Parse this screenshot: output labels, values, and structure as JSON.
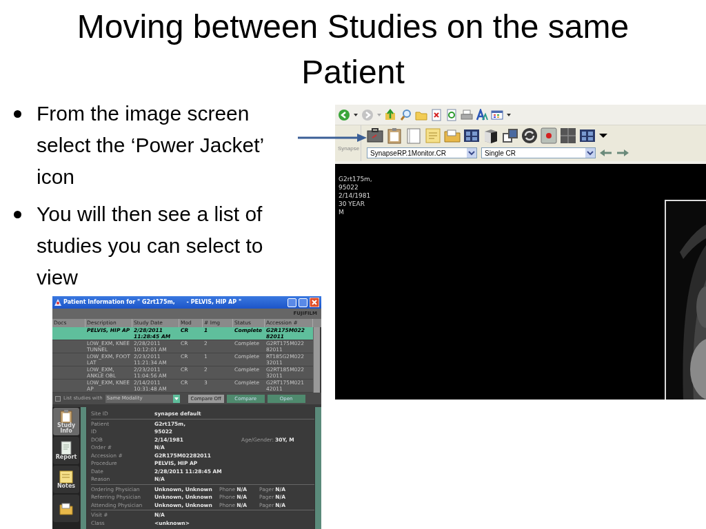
{
  "title": "Moving between Studies on the same Patient",
  "bullets": [
    "From the image screen select the ‘Power Jacket’ icon",
    "You will then see a list of studies you can select to view"
  ],
  "viewer": {
    "toolbar_label": "Synapse",
    "layout_select": "SynapseRP.1Monitor.CR",
    "view_select": "Single CR",
    "overlay_lines": [
      "G2rt175m,",
      "95022",
      "2/14/1981",
      "30 YEAR",
      "M"
    ]
  },
  "dialog": {
    "title": "Patient Information for \" G2rt175m,      - PELVIS, HIP AP \"",
    "brand": "FUJIFILM",
    "columns": [
      "Docs",
      "Description",
      "Study Date",
      "Mod",
      "# Img",
      "Status",
      "Accession #"
    ],
    "rows": [
      {
        "selected": true,
        "cells": [
          "",
          "PELVIS, HIP AP",
          "2/28/2011 11:28:45 AM",
          "CR",
          "1",
          "Complete",
          "G2R175M022 82011"
        ]
      },
      {
        "selected": false,
        "cells": [
          "",
          "LOW_EXM, KNEE TUNNEL",
          "2/28/2011 10:12:01 AM",
          "CR",
          "2",
          "Complete",
          "G2RT175M022 82011"
        ]
      },
      {
        "selected": false,
        "cells": [
          "",
          "LOW_EXM, FOOT LAT",
          "2/23/2011 11:21:34 AM",
          "CR",
          "1",
          "Complete",
          "RT185G2M022 32011"
        ]
      },
      {
        "selected": false,
        "cells": [
          "",
          "LOW_EXM, ANKLE OBL",
          "2/23/2011 11:04:56 AM",
          "CR",
          "2",
          "Complete",
          "G2RT185M022 32011"
        ]
      },
      {
        "selected": false,
        "cells": [
          "",
          "LOW_EXM, KNEE AP",
          "2/14/2011 10:31:48 AM",
          "CR",
          "3",
          "Complete",
          "G2RT175M021 42011"
        ]
      }
    ],
    "list_studies": {
      "label": "List studies with",
      "checked": false
    },
    "filter_select": "Same Modality",
    "buttons": [
      {
        "label": "Compare Off",
        "kind": "toggle"
      },
      {
        "label": "Compare",
        "kind": "action"
      },
      {
        "label": "Open",
        "kind": "action"
      }
    ],
    "side_tabs": [
      {
        "label": "Study Info",
        "selected": true
      },
      {
        "label": "Report",
        "selected": false
      },
      {
        "label": "Notes",
        "selected": false
      },
      {
        "selected": false
      }
    ],
    "details": [
      {
        "rows": [
          {
            "label": "Site ID",
            "value": "synapse default"
          }
        ]
      },
      {
        "rows": [
          {
            "label": "Patient",
            "value": "G2rt175m,"
          },
          {
            "label": "ID",
            "value": "95022"
          },
          {
            "label": "DOB",
            "value": "2/14/1981",
            "extras": [
              {
                "label": "Age/Gender:",
                "value": "30Y, M"
              }
            ]
          },
          {
            "label": "Order #",
            "value": "N/A"
          },
          {
            "label": "Accession #",
            "value": "G2R175M02282011"
          },
          {
            "label": "Procedure",
            "value": "PELVIS, HIP AP"
          },
          {
            "label": "Date",
            "value": "2/28/2011 11:28:45 AM"
          },
          {
            "label": "Reason",
            "value": "N/A"
          }
        ]
      },
      {
        "rows": [
          {
            "label": "Ordering Physician",
            "value": "Unknown, Unknown",
            "extras": [
              {
                "label": "Phone",
                "value": "N/A"
              },
              {
                "label": "Pager",
                "value": "N/A"
              }
            ]
          },
          {
            "label": "Referring Physician",
            "value": "Unknown, Unknown",
            "extras": [
              {
                "label": "Phone",
                "value": "N/A"
              },
              {
                "label": "Pager",
                "value": "N/A"
              }
            ]
          },
          {
            "label": "Attending Physician",
            "value": "Unknown, Unknown",
            "extras": [
              {
                "label": "Phone",
                "value": "N/A"
              },
              {
                "label": "Pager",
                "value": "N/A"
              }
            ]
          }
        ]
      },
      {
        "rows": [
          {
            "label": "Visit #",
            "value": "N/A"
          },
          {
            "label": "Class",
            "value": "<unknown>"
          }
        ]
      }
    ]
  }
}
